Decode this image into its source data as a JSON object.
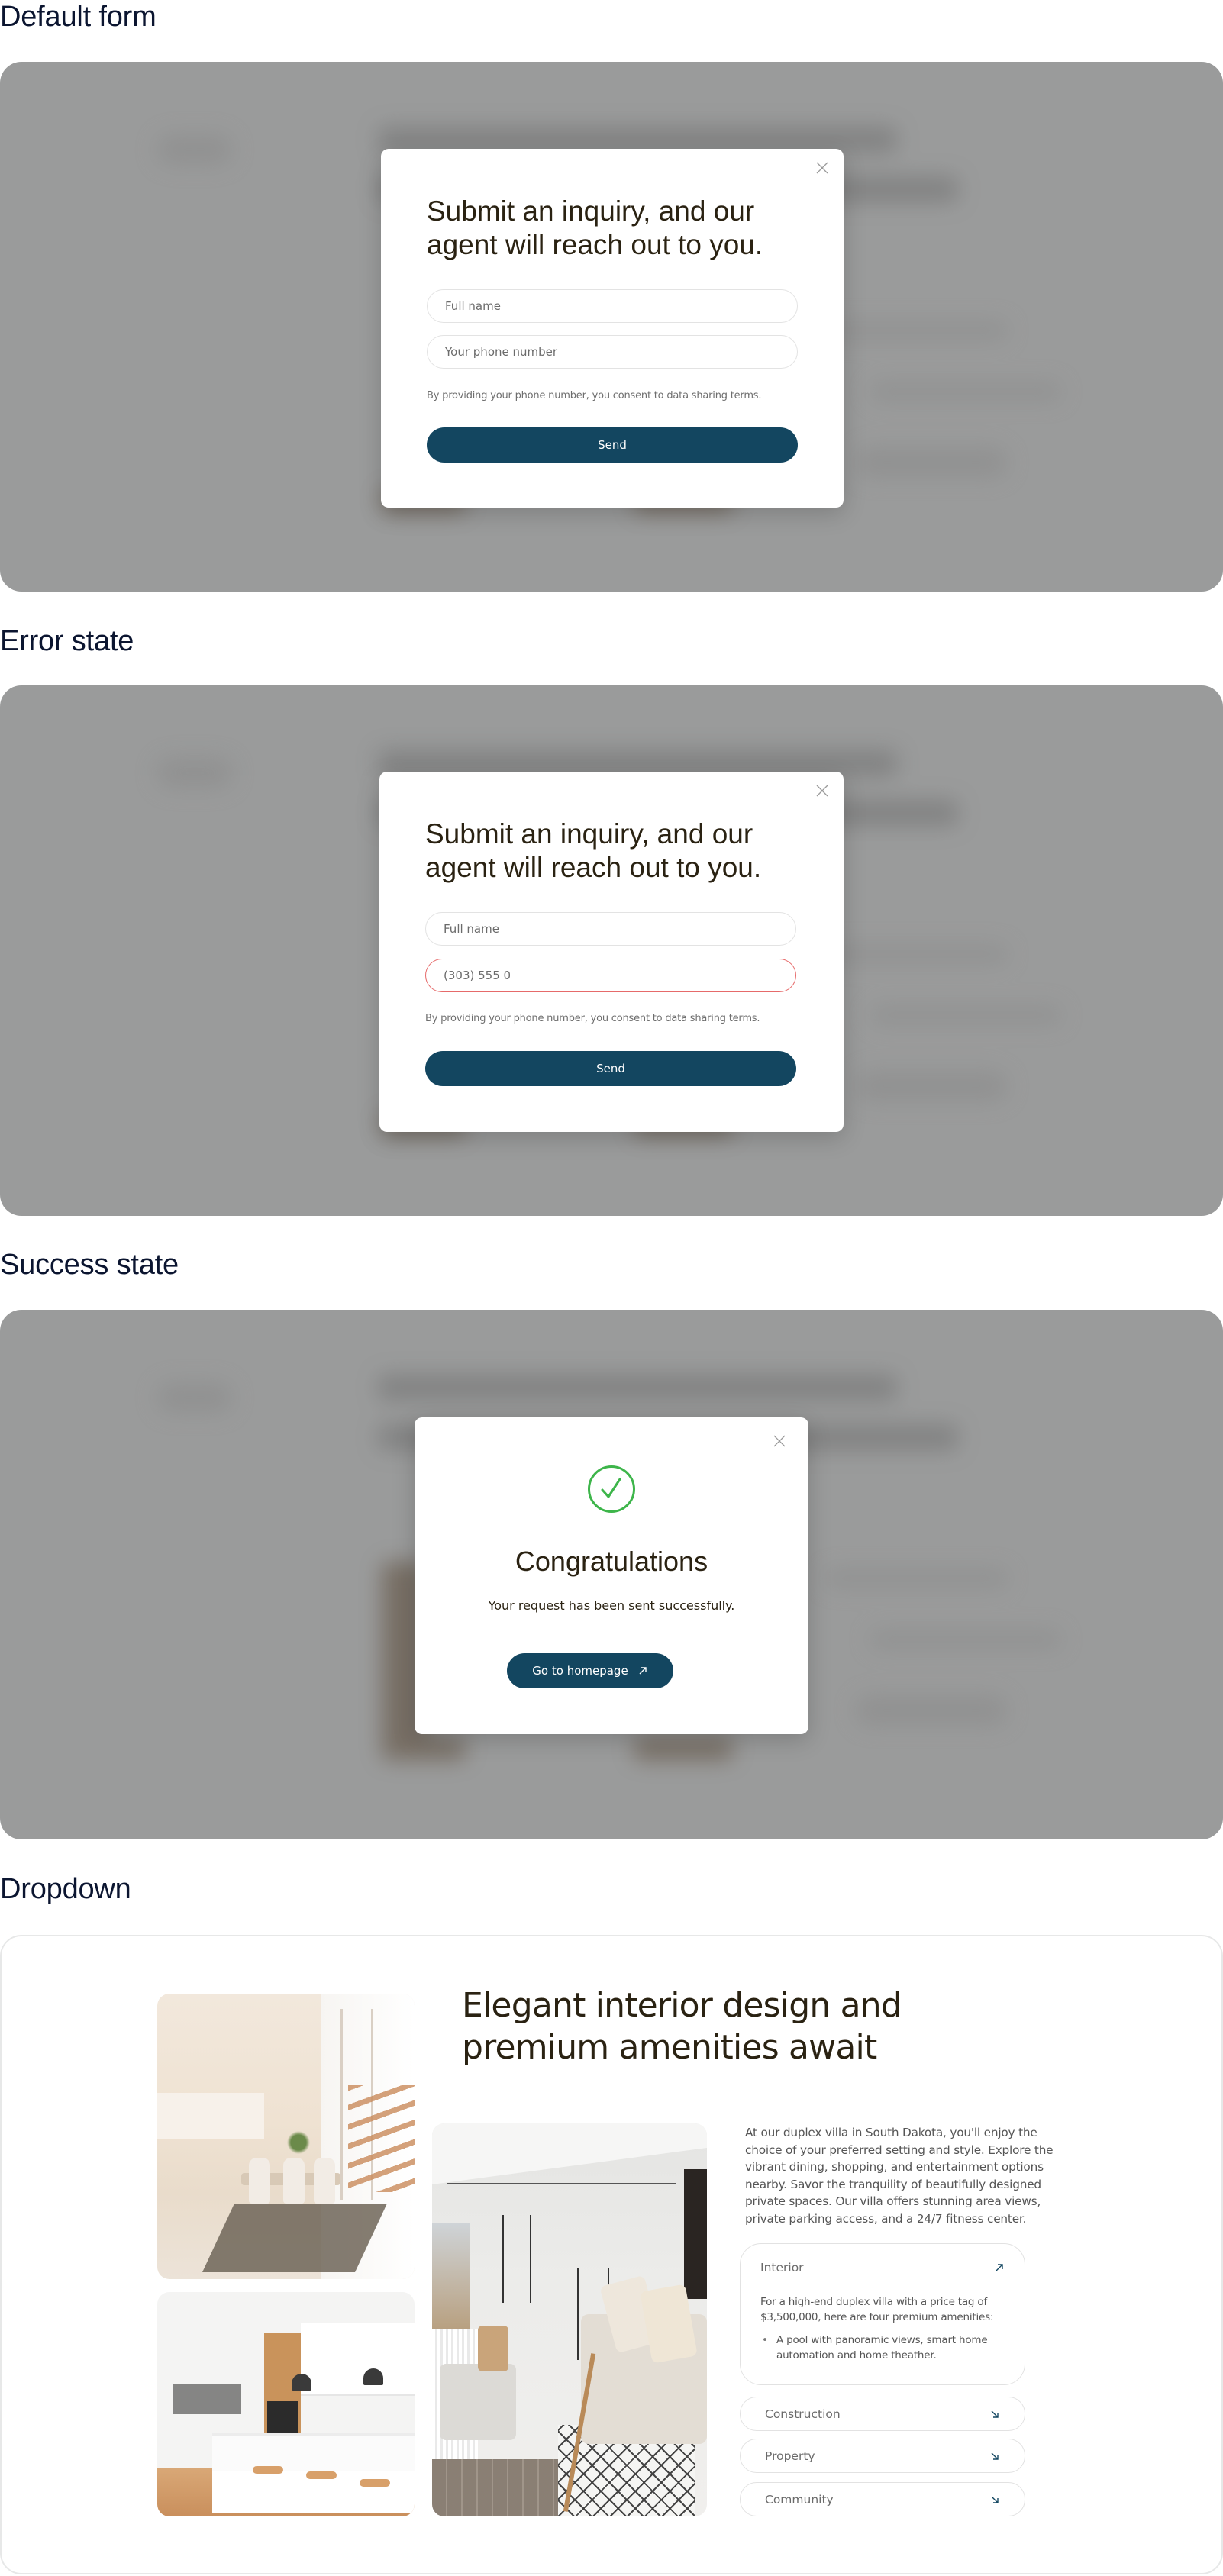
{
  "sections": {
    "default": {
      "title": "Default form"
    },
    "error": {
      "title": "Error state"
    },
    "success": {
      "title": "Success state"
    },
    "dropdown": {
      "title": "Dropdown"
    }
  },
  "inquiry_form": {
    "title": "Submit an inquiry, and our agent will reach out to you.",
    "name_placeholder": "Full name",
    "phone_placeholder": "Your phone number",
    "consent": "By providing your phone number, you consent to data sharing terms.",
    "send_label": "Send",
    "close_icon": "close-icon"
  },
  "error_form": {
    "phone_value": "(303) 555 0",
    "error_color": "#e66a6a"
  },
  "success_modal": {
    "icon": "check-circle-icon",
    "title": "Congratulations",
    "message": "Your request has been sent successfully.",
    "button_label": "Go to homepage",
    "button_icon": "arrow-up-right-icon",
    "success_color": "#3db54a"
  },
  "dropdown_page": {
    "heading": "Elegant interior design and premium amenities await",
    "body": "At our duplex villa in South Dakota, you'll enjoy the choice of your preferred setting and style. Explore the vibrant dining, shopping, and entertainment options nearby. Savor the tranquility of beautifully designed private spaces. Our villa offers stunning area views, private parking access, and a 24/7 fitness center.",
    "images": [
      {
        "alt": "Dining room with staircase"
      },
      {
        "alt": "Modern kitchen with bar stools"
      },
      {
        "alt": "Balcony lounge with plants"
      }
    ],
    "accordion": [
      {
        "title": "Interior",
        "open": true,
        "icon": "arrow-up-right-icon",
        "description": "For a high-end duplex villa with a price tag of $3,500,000, here are four premium amenities:",
        "bullets": [
          "A pool with panoramic views, smart home automation and home theather."
        ]
      },
      {
        "title": "Construction",
        "open": false,
        "icon": "arrow-down-right-icon"
      },
      {
        "title": "Property",
        "open": false,
        "icon": "arrow-down-right-icon"
      },
      {
        "title": "Community",
        "open": false,
        "icon": "arrow-down-right-icon"
      }
    ]
  },
  "colors": {
    "primary": "#134660",
    "heading_text": "#2a2212",
    "overlay": "#9a9b9b"
  }
}
